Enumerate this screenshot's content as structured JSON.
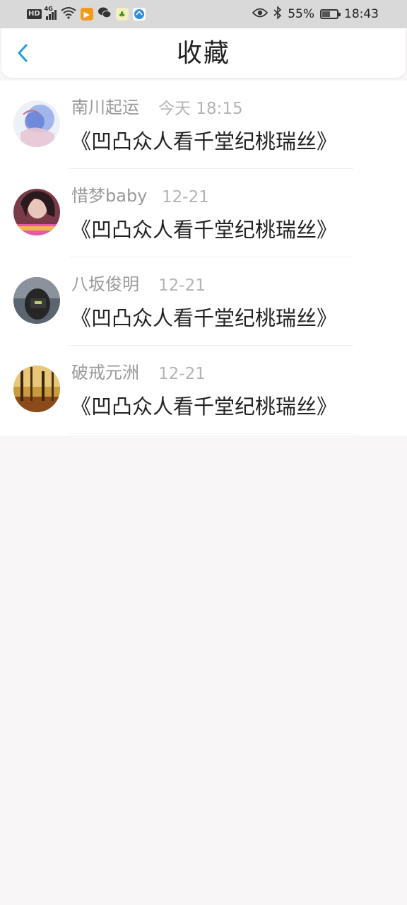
{
  "status_bar": {
    "hd_label": "HD",
    "network_label": "4G",
    "battery": "55%",
    "battery_level": 0.55,
    "time": "18:43"
  },
  "header": {
    "title": "收藏",
    "back_icon": "chevron-left-icon"
  },
  "colors": {
    "accent": "#1e9ee0",
    "name_gray": "#9a9a9a",
    "time_gray": "#b4b4b4",
    "title_text": "#222222",
    "page_background": "#f8f6f7"
  },
  "favorites": [
    {
      "user": "南川起运",
      "time": "今天 18:15",
      "title": "《凹凸众人看千堂纪桃瑞丝》"
    },
    {
      "user": "惜梦baby",
      "time": "12-21",
      "title": "《凹凸众人看千堂纪桃瑞丝》"
    },
    {
      "user": "八坂俊明",
      "time": "12-21",
      "title": "《凹凸众人看千堂纪桃瑞丝》"
    },
    {
      "user": "破戒元洲",
      "time": "12-21",
      "title": "《凹凸众人看千堂纪桃瑞丝》"
    }
  ]
}
